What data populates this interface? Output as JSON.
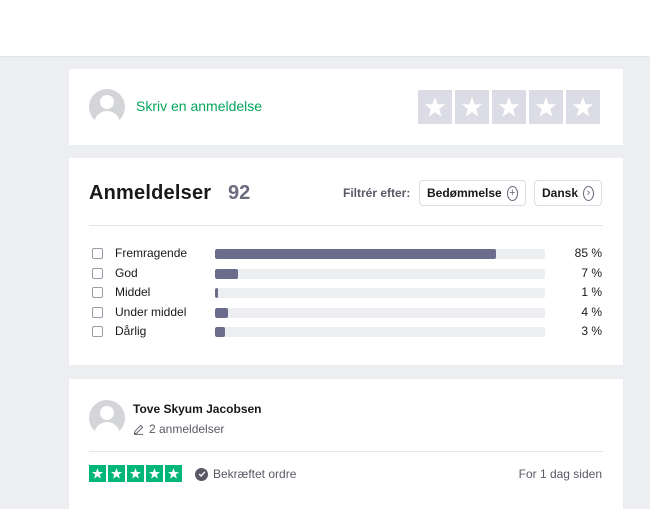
{
  "write_review": {
    "link_label": "Skriv en anmeldelse",
    "star_count": 5,
    "star_color": "#dcdce6"
  },
  "reviews": {
    "title": "Anmeldelser",
    "count": "92",
    "filter_label": "Filtrér efter:",
    "filter_rating_label": "Bedømmelse",
    "filter_language_label": "Dansk",
    "distribution": [
      {
        "label": "Fremragende",
        "percent": 85,
        "percent_text": "85 %"
      },
      {
        "label": "God",
        "percent": 7,
        "percent_text": "7 %"
      },
      {
        "label": "Middel",
        "percent": 1,
        "percent_text": "1 %"
      },
      {
        "label": "Under middel",
        "percent": 4,
        "percent_text": "4 %"
      },
      {
        "label": "Dårlig",
        "percent": 3,
        "percent_text": "3 %"
      }
    ]
  },
  "review": {
    "author": "Tove Skyum Jacobsen",
    "author_reviews": "2 anmeldelser",
    "rating": 5,
    "verified_label": "Bekræftet ordre",
    "date": "For 1 dag siden"
  },
  "colors": {
    "accent_green": "#04a65a",
    "star_green": "#00b67a",
    "bar_fill": "#6b6b8c",
    "page_background": "#edeef1"
  }
}
